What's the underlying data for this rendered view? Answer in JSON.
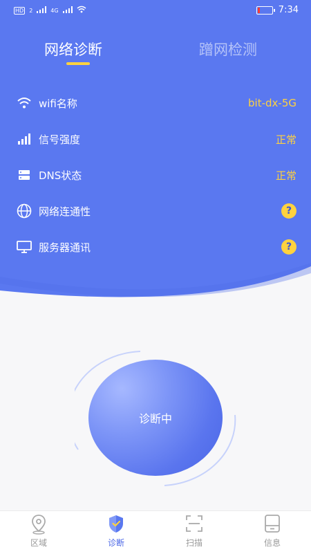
{
  "status_bar": {
    "network_badges": [
      "HD",
      "2",
      "4G"
    ],
    "time": "7:34"
  },
  "tabs": [
    {
      "label": "网络诊断",
      "active": true
    },
    {
      "label": "蹭网检测",
      "active": false
    }
  ],
  "info_rows": [
    {
      "icon": "wifi-icon",
      "label": "wifi名称",
      "value": "bit-dx-5G"
    },
    {
      "icon": "signal-icon",
      "label": "信号强度",
      "value": "正常"
    },
    {
      "icon": "server-icon",
      "label": "DNS状态",
      "value": "正常"
    },
    {
      "icon": "globe-icon",
      "label": "网络连通性",
      "value": "?"
    },
    {
      "icon": "monitor-icon",
      "label": "服务器通讯",
      "value": "?"
    }
  ],
  "diagnose_button": {
    "label": "诊断中"
  },
  "bottom_nav": [
    {
      "label": "区域",
      "icon": "location-icon",
      "active": false
    },
    {
      "label": "诊断",
      "icon": "shield-check-icon",
      "active": true
    },
    {
      "label": "扫描",
      "icon": "scan-icon",
      "active": false
    },
    {
      "label": "信息",
      "icon": "device-icon",
      "active": false
    }
  ],
  "colors": {
    "primary": "#5a78f0",
    "accent": "#ffd23f",
    "background": "#f7f7f9"
  }
}
